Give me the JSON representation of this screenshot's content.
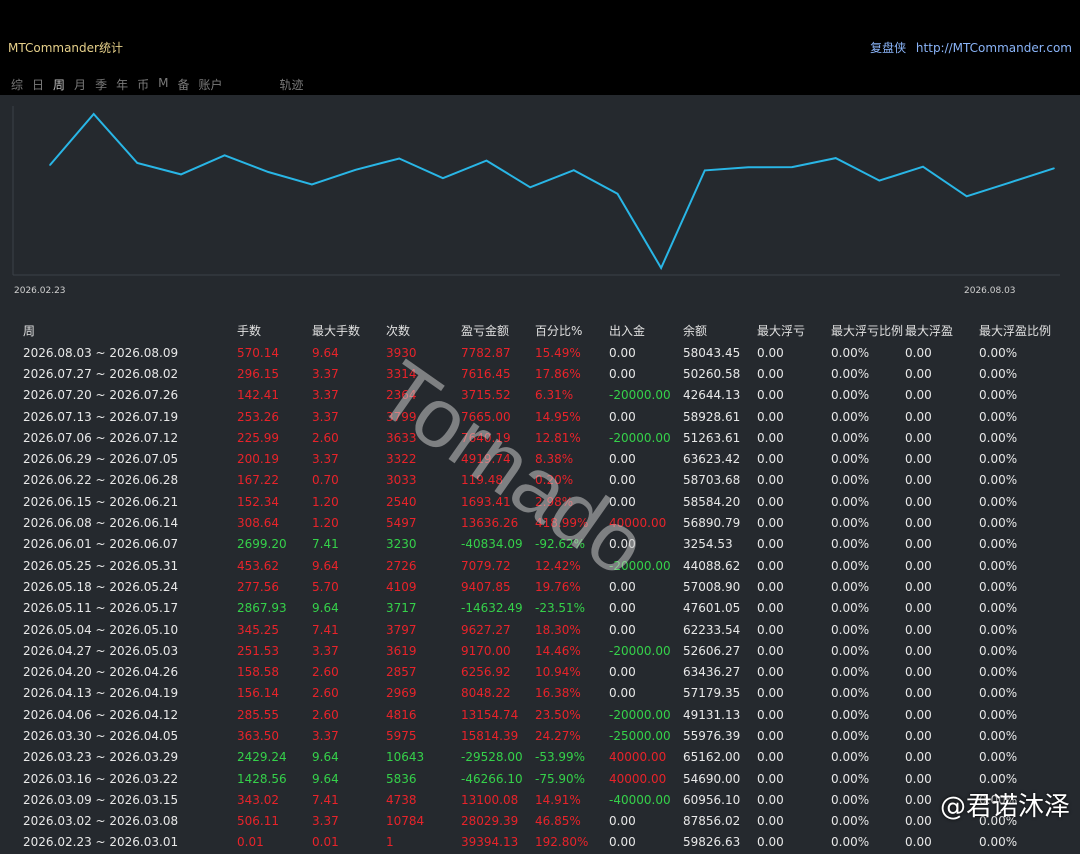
{
  "header": {
    "title": "MTCommander统计",
    "brand": "复盘侠",
    "url": "http://MTCommander.com"
  },
  "tabs": [
    "综",
    "日",
    "周",
    "月",
    "季",
    "年",
    "币",
    "M",
    "备",
    "账户",
    "轨迹"
  ],
  "active_tab": "周",
  "chart_data": {
    "type": "line",
    "x_start_label": "2026.02.23",
    "x_end_label": "2026.08.03",
    "values": [
      59826.63,
      87856.02,
      60956.1,
      54690.0,
      65162.0,
      55976.39,
      49131.13,
      57179.35,
      63436.27,
      52606.27,
      62233.54,
      47601.05,
      57008.9,
      44088.62,
      3254.53,
      56890.79,
      58584.2,
      58703.68,
      63623.42,
      51263.61,
      58928.61,
      42644.13,
      50260.58,
      58043.45
    ],
    "line_color": "#29b6e6"
  },
  "table": {
    "headers": [
      "周",
      "手数",
      "最大手数",
      "次数",
      "盈亏金额",
      "百分比%",
      "出入金",
      "余额",
      "最大浮亏",
      "最大浮亏比例",
      "最大浮盈",
      "最大浮盈比例"
    ],
    "rows": [
      [
        "2026.08.03 ~ 2026.08.09",
        "570.14",
        "9.64",
        "3930",
        "7782.87",
        "15.49%",
        "0.00",
        "58043.45",
        "0.00",
        "0.00%",
        "0.00",
        "0.00%"
      ],
      [
        "2026.07.27 ~ 2026.08.02",
        "296.15",
        "3.37",
        "3314",
        "7616.45",
        "17.86%",
        "0.00",
        "50260.58",
        "0.00",
        "0.00%",
        "0.00",
        "0.00%"
      ],
      [
        "2026.07.20 ~ 2026.07.26",
        "142.41",
        "3.37",
        "2364",
        "3715.52",
        "6.31%",
        "-20000.00",
        "42644.13",
        "0.00",
        "0.00%",
        "0.00",
        "0.00%"
      ],
      [
        "2026.07.13 ~ 2026.07.19",
        "253.26",
        "3.37",
        "3799",
        "7665.00",
        "14.95%",
        "0.00",
        "58928.61",
        "0.00",
        "0.00%",
        "0.00",
        "0.00%"
      ],
      [
        "2026.07.06 ~ 2026.07.12",
        "225.99",
        "2.60",
        "3633",
        "7640.19",
        "12.81%",
        "-20000.00",
        "51263.61",
        "0.00",
        "0.00%",
        "0.00",
        "0.00%"
      ],
      [
        "2026.06.29 ~ 2026.07.05",
        "200.19",
        "3.37",
        "3322",
        "4919.74",
        "8.38%",
        "0.00",
        "63623.42",
        "0.00",
        "0.00%",
        "0.00",
        "0.00%"
      ],
      [
        "2026.06.22 ~ 2026.06.28",
        "167.22",
        "0.70",
        "3033",
        "119.48",
        "0.20%",
        "0.00",
        "58703.68",
        "0.00",
        "0.00%",
        "0.00",
        "0.00%"
      ],
      [
        "2026.06.15 ~ 2026.06.21",
        "152.34",
        "1.20",
        "2540",
        "1693.41",
        "2.98%",
        "0.00",
        "58584.20",
        "0.00",
        "0.00%",
        "0.00",
        "0.00%"
      ],
      [
        "2026.06.08 ~ 2026.06.14",
        "308.64",
        "1.20",
        "5497",
        "13636.26",
        "418.99%",
        "40000.00",
        "56890.79",
        "0.00",
        "0.00%",
        "0.00",
        "0.00%"
      ],
      [
        "2026.06.01 ~ 2026.06.07",
        "2699.20",
        "7.41",
        "3230",
        "-40834.09",
        "-92.62%",
        "0.00",
        "3254.53",
        "0.00",
        "0.00%",
        "0.00",
        "0.00%"
      ],
      [
        "2026.05.25 ~ 2026.05.31",
        "453.62",
        "9.64",
        "2726",
        "7079.72",
        "12.42%",
        "-20000.00",
        "44088.62",
        "0.00",
        "0.00%",
        "0.00",
        "0.00%"
      ],
      [
        "2026.05.18 ~ 2026.05.24",
        "277.56",
        "5.70",
        "4109",
        "9407.85",
        "19.76%",
        "0.00",
        "57008.90",
        "0.00",
        "0.00%",
        "0.00",
        "0.00%"
      ],
      [
        "2026.05.11 ~ 2026.05.17",
        "2867.93",
        "9.64",
        "3717",
        "-14632.49",
        "-23.51%",
        "0.00",
        "47601.05",
        "0.00",
        "0.00%",
        "0.00",
        "0.00%"
      ],
      [
        "2026.05.04 ~ 2026.05.10",
        "345.25",
        "7.41",
        "3797",
        "9627.27",
        "18.30%",
        "0.00",
        "62233.54",
        "0.00",
        "0.00%",
        "0.00",
        "0.00%"
      ],
      [
        "2026.04.27 ~ 2026.05.03",
        "251.53",
        "3.37",
        "3619",
        "9170.00",
        "14.46%",
        "-20000.00",
        "52606.27",
        "0.00",
        "0.00%",
        "0.00",
        "0.00%"
      ],
      [
        "2026.04.20 ~ 2026.04.26",
        "158.58",
        "2.60",
        "2857",
        "6256.92",
        "10.94%",
        "0.00",
        "63436.27",
        "0.00",
        "0.00%",
        "0.00",
        "0.00%"
      ],
      [
        "2026.04.13 ~ 2026.04.19",
        "156.14",
        "2.60",
        "2969",
        "8048.22",
        "16.38%",
        "0.00",
        "57179.35",
        "0.00",
        "0.00%",
        "0.00",
        "0.00%"
      ],
      [
        "2026.04.06 ~ 2026.04.12",
        "285.55",
        "2.60",
        "4816",
        "13154.74",
        "23.50%",
        "-20000.00",
        "49131.13",
        "0.00",
        "0.00%",
        "0.00",
        "0.00%"
      ],
      [
        "2026.03.30 ~ 2026.04.05",
        "363.50",
        "3.37",
        "5975",
        "15814.39",
        "24.27%",
        "-25000.00",
        "55976.39",
        "0.00",
        "0.00%",
        "0.00",
        "0.00%"
      ],
      [
        "2026.03.23 ~ 2026.03.29",
        "2429.24",
        "9.64",
        "10643",
        "-29528.00",
        "-53.99%",
        "40000.00",
        "65162.00",
        "0.00",
        "0.00%",
        "0.00",
        "0.00%"
      ],
      [
        "2026.03.16 ~ 2026.03.22",
        "1428.56",
        "9.64",
        "5836",
        "-46266.10",
        "-75.90%",
        "40000.00",
        "54690.00",
        "0.00",
        "0.00%",
        "0.00",
        "0.00%"
      ],
      [
        "2026.03.09 ~ 2026.03.15",
        "343.02",
        "7.41",
        "4738",
        "13100.08",
        "14.91%",
        "-40000.00",
        "60956.10",
        "0.00",
        "0.00%",
        "0.00",
        "0.00%"
      ],
      [
        "2026.03.02 ~ 2026.03.08",
        "506.11",
        "3.37",
        "10784",
        "28029.39",
        "46.85%",
        "0.00",
        "87856.02",
        "0.00",
        "0.00%",
        "0.00",
        "0.00%"
      ],
      [
        "2026.02.23 ~ 2026.03.01",
        "0.01",
        "0.01",
        "1",
        "39394.13",
        "192.80%",
        "0.00",
        "59826.63",
        "0.00",
        "0.00%",
        "0.00",
        "0.00%"
      ]
    ]
  },
  "watermark": "Tornado",
  "credit": "@君诺沐泽"
}
